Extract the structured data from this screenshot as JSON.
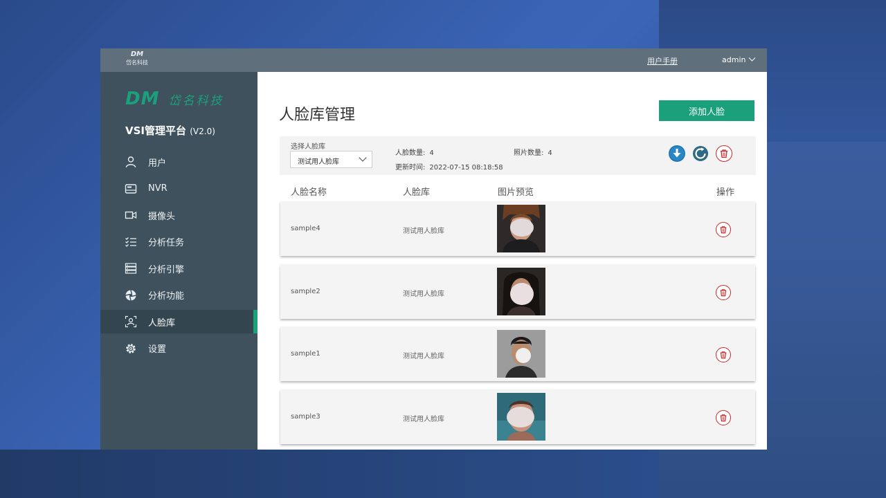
{
  "topbar": {
    "mini_logo_dm": "DM",
    "mini_logo_cn": "岱名科技",
    "manual_link": "用户手册",
    "user_name": "admin"
  },
  "sidebar": {
    "brand_dm": "DM",
    "brand_cn": "岱名科技",
    "platform_title": "VSI管理平台",
    "platform_version": "(V2.0)",
    "items": [
      {
        "label": "用户",
        "icon": "user-icon"
      },
      {
        "label": "NVR",
        "icon": "nvr-icon"
      },
      {
        "label": "摄像头",
        "icon": "camera-icon"
      },
      {
        "label": "分析任务",
        "icon": "task-list-icon"
      },
      {
        "label": "分析引擎",
        "icon": "server-icon"
      },
      {
        "label": "分析功能",
        "icon": "aperture-icon"
      },
      {
        "label": "人脸库",
        "icon": "face-scan-icon",
        "active": true
      },
      {
        "label": "设置",
        "icon": "gear-icon"
      }
    ],
    "accent_color": "#1aa07a"
  },
  "main": {
    "title": "人脸库管理",
    "add_button": "添加人脸",
    "filter": {
      "select_label": "选择人脸库",
      "selected_library": "测试用人脸库",
      "face_count_label": "人脸数量:",
      "face_count": "4",
      "photo_count_label": "照片数量:",
      "photo_count": "4",
      "updated_label": "更新时间:",
      "updated_time": "2022-07-15 08:18:58"
    },
    "columns": [
      "人脸名称",
      "人脸库",
      "图片预览",
      "操作"
    ],
    "rows": [
      {
        "name": "sample4",
        "library": "测试用人脸库"
      },
      {
        "name": "sample2",
        "library": "测试用人脸库"
      },
      {
        "name": "sample1",
        "library": "测试用人脸库"
      },
      {
        "name": "sample3",
        "library": "测试用人脸库"
      }
    ]
  }
}
